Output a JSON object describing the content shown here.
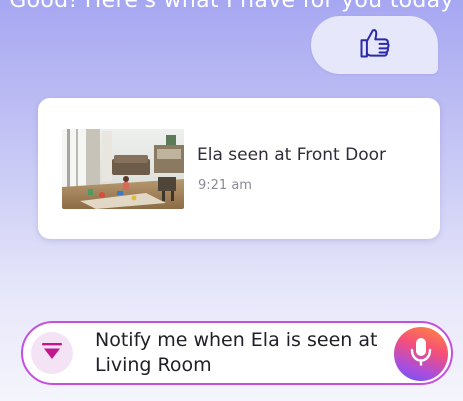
{
  "header": {
    "text": "Good! Here's what I have for you today"
  },
  "reply_bubble": {
    "icon": "thumbs-up-icon"
  },
  "event_card": {
    "thumbnail": "living-room-camera-snapshot",
    "title": "Ela seen at Front Door",
    "time": "9:21 am"
  },
  "voice_input": {
    "text": "Notify me when Ela is seen at Living Room",
    "left_icon": "filter-icon",
    "right_icon": "microphone-icon"
  },
  "colors": {
    "accent_border": "#c64fe0",
    "thumbs_stroke": "#2a2aa8",
    "filter_icon": "#c2168f",
    "bubble_bg": "#e6e7fb"
  }
}
